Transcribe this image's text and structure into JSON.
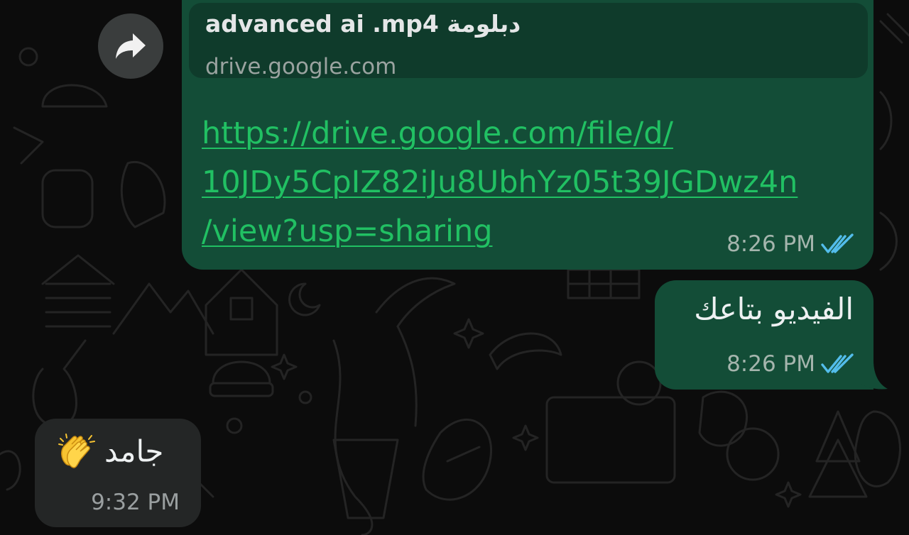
{
  "messages": {
    "link": {
      "preview_title": "advanced ai .mp4 دبلومة",
      "preview_domain": "drive.google.com",
      "url_lines": [
        "https://drive.google.com/file/d/",
        "10JDy5CpIZ82iJu8UbhYz05t39JGDwz4n",
        "/view?usp=sharing"
      ],
      "time": "8:26 PM",
      "status_icon": "double-check-read-icon"
    },
    "text_out": {
      "text": "الفيديو بتاعك",
      "time": "8:26 PM",
      "status_icon": "double-check-read-icon"
    },
    "text_in": {
      "text": "جامد",
      "emoji": "clapping-hands",
      "time": "9:32 PM"
    }
  },
  "forward_icon": "forward-arrow-icon",
  "colors": {
    "outgoing_bubble": "#134d37",
    "incoming_bubble": "#242626",
    "link": "#21c063",
    "read_ticks": "#53bdeb",
    "background": "#0c0c0c"
  }
}
